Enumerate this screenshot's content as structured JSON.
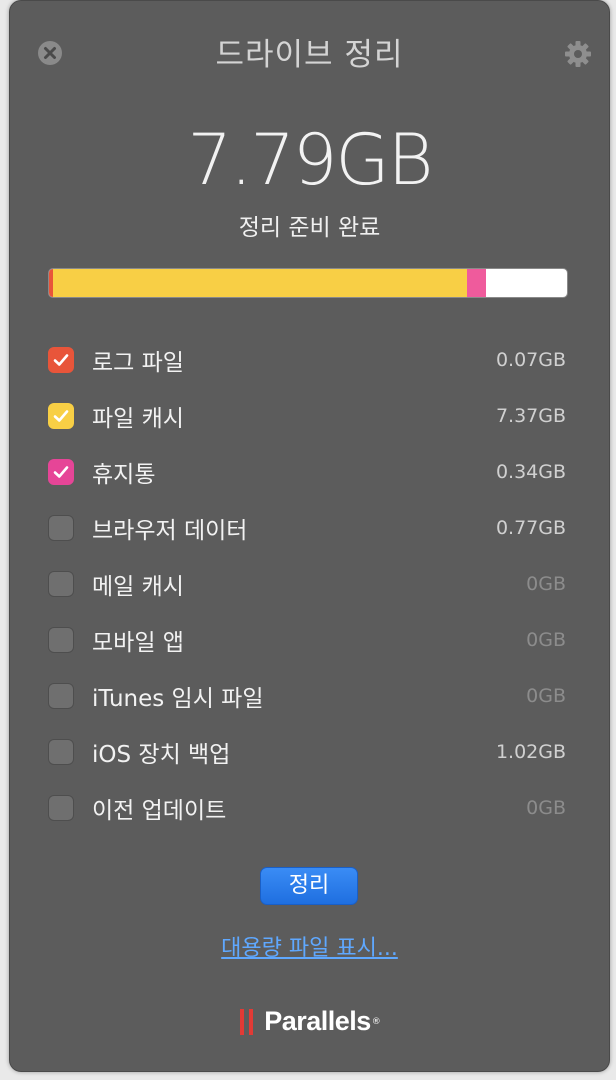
{
  "header": {
    "title": "드라이브 정리",
    "close_icon": "close-circle-icon",
    "settings_icon": "gear-icon"
  },
  "summary": {
    "total_size": "7.79GB",
    "status": "정리 준비 완료"
  },
  "usage_bar": {
    "segments": [
      {
        "name": "로그 파일",
        "gb": 0.07,
        "color": "#e8553a"
      },
      {
        "name": "파일 캐시",
        "gb": 7.37,
        "color": "#f8cf45"
      },
      {
        "name": "휴지통",
        "gb": 0.34,
        "color": "#ef5b9c"
      }
    ],
    "capacity_gb": 9.22
  },
  "items": [
    {
      "label": "로그 파일",
      "size": "0.07GB",
      "checked": true,
      "color": "#e8553a"
    },
    {
      "label": "파일 캐시",
      "size": "7.37GB",
      "checked": true,
      "color": "#f8cf45"
    },
    {
      "label": "휴지통",
      "size": "0.34GB",
      "checked": true,
      "color": "#e64597"
    },
    {
      "label": "브라우저 데이터",
      "size": "0.77GB",
      "checked": false,
      "color": ""
    },
    {
      "label": "메일 캐시",
      "size": "0GB",
      "checked": false,
      "color": ""
    },
    {
      "label": "모바일 앱",
      "size": "0GB",
      "checked": false,
      "color": ""
    },
    {
      "label": "iTunes 임시 파일",
      "size": "0GB",
      "checked": false,
      "color": ""
    },
    {
      "label": "iOS 장치 백업",
      "size": "1.02GB",
      "checked": false,
      "color": ""
    },
    {
      "label": "이전 업데이트",
      "size": "0GB",
      "checked": false,
      "color": ""
    }
  ],
  "actions": {
    "clean_label": "정리",
    "show_large_files_label": "대용량 파일 표시..."
  },
  "footer": {
    "brand_name": "Parallels",
    "brand_mark": "®",
    "brand_color": "#e23a35"
  }
}
